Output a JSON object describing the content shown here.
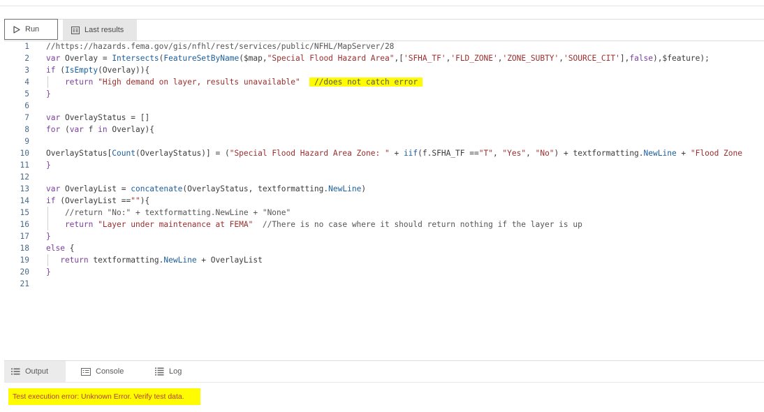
{
  "toolbar": {
    "run_label": "Run",
    "last_results_label": "Last results"
  },
  "editor": {
    "lines": [
      {
        "n": "1",
        "tokens": [
          {
            "t": "//https://hazards.fema.gov/gis/nfhl/rest/services/public/NFHL/MapServer/28",
            "c": "cm"
          }
        ]
      },
      {
        "n": "2",
        "tokens": [
          {
            "t": "var ",
            "c": "kw"
          },
          {
            "t": "Overlay = ",
            "c": "plain"
          },
          {
            "t": "Intersects",
            "c": "fn"
          },
          {
            "t": "(",
            "c": "plain"
          },
          {
            "t": "FeatureSetByName",
            "c": "fn"
          },
          {
            "t": "($map,",
            "c": "plain"
          },
          {
            "t": "\"Special Flood Hazard Area\"",
            "c": "str"
          },
          {
            "t": ",[",
            "c": "plain"
          },
          {
            "t": "'SFHA_TF'",
            "c": "str"
          },
          {
            "t": ",",
            "c": "plain"
          },
          {
            "t": "'FLD_ZONE'",
            "c": "str"
          },
          {
            "t": ",",
            "c": "plain"
          },
          {
            "t": "'ZONE_SUBTY'",
            "c": "str"
          },
          {
            "t": ",",
            "c": "plain"
          },
          {
            "t": "'SOURCE_CIT'",
            "c": "str"
          },
          {
            "t": "],",
            "c": "plain"
          },
          {
            "t": "false",
            "c": "kw"
          },
          {
            "t": "),$feature);",
            "c": "plain"
          }
        ]
      },
      {
        "n": "3",
        "tokens": [
          {
            "t": "if ",
            "c": "kw"
          },
          {
            "t": "(",
            "c": "plain"
          },
          {
            "t": "IsEmpty",
            "c": "fn"
          },
          {
            "t": "(Overlay)){",
            "c": "plain"
          }
        ]
      },
      {
        "n": "4",
        "tokens": [
          {
            "t": "    return ",
            "c": "kw"
          },
          {
            "t": "\"High demand on layer, results unavailable\"",
            "c": "str"
          },
          {
            "t": "  ",
            "c": "plain"
          },
          {
            "t": " //does not catch error ",
            "c": "cm hl"
          }
        ]
      },
      {
        "n": "5",
        "tokens": [
          {
            "t": "}",
            "c": "kw"
          }
        ]
      },
      {
        "n": "6",
        "tokens": []
      },
      {
        "n": "7",
        "tokens": [
          {
            "t": "var ",
            "c": "kw"
          },
          {
            "t": "OverlayStatus = []",
            "c": "plain"
          }
        ]
      },
      {
        "n": "8",
        "tokens": [
          {
            "t": "for ",
            "c": "kw"
          },
          {
            "t": "(",
            "c": "plain"
          },
          {
            "t": "var ",
            "c": "kw"
          },
          {
            "t": "f ",
            "c": "plain"
          },
          {
            "t": "in ",
            "c": "kw"
          },
          {
            "t": "Overlay){",
            "c": "plain"
          }
        ]
      },
      {
        "n": "9",
        "tokens": []
      },
      {
        "n": "10",
        "tokens": [
          {
            "t": "OverlayStatus[",
            "c": "plain"
          },
          {
            "t": "Count",
            "c": "fn"
          },
          {
            "t": "(OverlayStatus)] = (",
            "c": "plain"
          },
          {
            "t": "\"Special Flood Hazard Area Zone: \"",
            "c": "str"
          },
          {
            "t": " + ",
            "c": "plain"
          },
          {
            "t": "iif",
            "c": "fn"
          },
          {
            "t": "(f.SFHA_TF ==",
            "c": "plain"
          },
          {
            "t": "\"T\"",
            "c": "str"
          },
          {
            "t": ", ",
            "c": "plain"
          },
          {
            "t": "\"Yes\"",
            "c": "str"
          },
          {
            "t": ", ",
            "c": "plain"
          },
          {
            "t": "\"No\"",
            "c": "str"
          },
          {
            "t": ") + textformatting.",
            "c": "plain"
          },
          {
            "t": "NewLine",
            "c": "fn"
          },
          {
            "t": " + ",
            "c": "plain"
          },
          {
            "t": "\"Flood Zone",
            "c": "str"
          }
        ]
      },
      {
        "n": "11",
        "tokens": [
          {
            "t": "}",
            "c": "kw"
          }
        ]
      },
      {
        "n": "12",
        "tokens": []
      },
      {
        "n": "13",
        "tokens": [
          {
            "t": "var ",
            "c": "kw"
          },
          {
            "t": "OverlayList = ",
            "c": "plain"
          },
          {
            "t": "concatenate",
            "c": "fn"
          },
          {
            "t": "(OverlayStatus, textformatting.",
            "c": "plain"
          },
          {
            "t": "NewLine",
            "c": "fn"
          },
          {
            "t": ")",
            "c": "plain"
          }
        ]
      },
      {
        "n": "14",
        "tokens": [
          {
            "t": "if ",
            "c": "kw"
          },
          {
            "t": "(OverlayList ==",
            "c": "plain"
          },
          {
            "t": "\"\"",
            "c": "str"
          },
          {
            "t": "){",
            "c": "plain"
          }
        ]
      },
      {
        "n": "15",
        "tokens": [
          {
            "t": "    //return \"No:\" + textformatting.NewLine + \"None\"",
            "c": "cm"
          }
        ]
      },
      {
        "n": "16",
        "tokens": [
          {
            "t": "    return ",
            "c": "kw"
          },
          {
            "t": "\"Layer under maintenance at FEMA\"",
            "c": "str"
          },
          {
            "t": "  //There is no case where it should return nothing if the layer is up",
            "c": "cm"
          }
        ]
      },
      {
        "n": "17",
        "tokens": [
          {
            "t": "}",
            "c": "kw"
          }
        ]
      },
      {
        "n": "18",
        "tokens": [
          {
            "t": "else ",
            "c": "kw"
          },
          {
            "t": "{",
            "c": "plain"
          }
        ]
      },
      {
        "n": "19",
        "tokens": [
          {
            "t": "   return ",
            "c": "kw"
          },
          {
            "t": "textformatting.",
            "c": "plain"
          },
          {
            "t": "NewLine",
            "c": "fn"
          },
          {
            "t": " + OverlayList",
            "c": "plain"
          }
        ]
      },
      {
        "n": "20",
        "tokens": [
          {
            "t": "}",
            "c": "kw"
          }
        ]
      },
      {
        "n": "21",
        "tokens": []
      }
    ]
  },
  "bottom_tabs": {
    "output_label": "Output",
    "console_label": "Console",
    "log_label": "Log"
  },
  "output": {
    "message": "Test execution error: Unknown Error. Verify test data."
  },
  "colors": {
    "highlight": "#fffb00",
    "error_text": "#b0402a"
  },
  "icons": {
    "run": "play-icon",
    "last_results": "results-icon",
    "output": "list-icon",
    "console": "console-icon",
    "log": "log-icon"
  }
}
